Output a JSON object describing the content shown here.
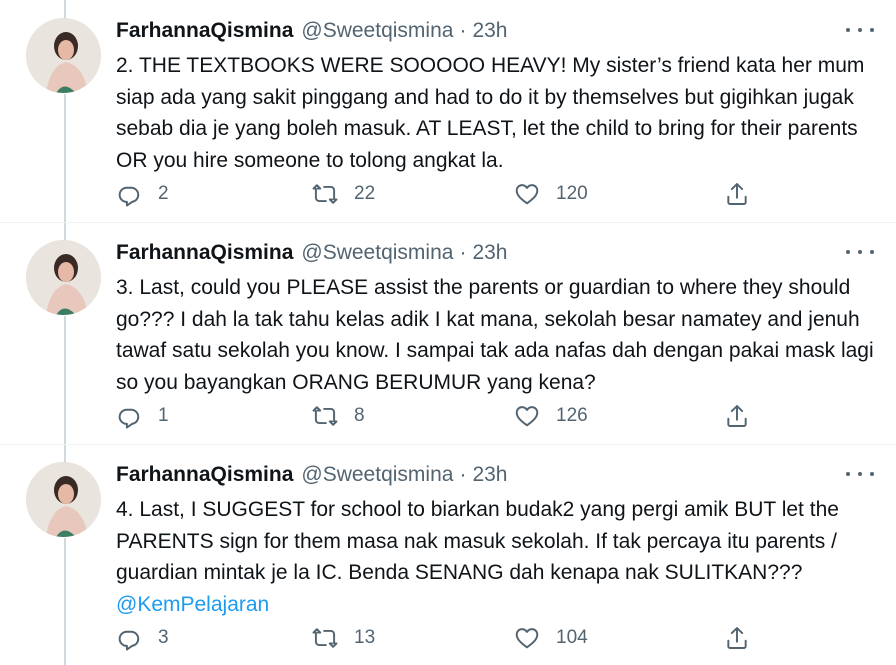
{
  "tweets": [
    {
      "name": "FarhannaQismina",
      "handle": "@Sweetqismina",
      "separator": "·",
      "time": "23h",
      "text": "2. THE TEXTBOOKS WERE SOOOOO HEAVY! My sister’s friend kata her mum siap ada yang sakit pinggang and had to do it by themselves but gigihkan jugak sebab dia je yang boleh masuk. AT LEAST, let the child to bring for their parents OR you hire someone to tolong angkat la.",
      "mention": "",
      "replies": "2",
      "retweets": "22",
      "likes": "120"
    },
    {
      "name": "FarhannaQismina",
      "handle": "@Sweetqismina",
      "separator": "·",
      "time": "23h",
      "text": "3. Last, could you PLEASE assist the parents or guardian to where they should go??? I dah la tak tahu kelas adik I kat mana, sekolah besar namatey and jenuh tawaf satu sekolah you know. I sampai tak ada nafas dah dengan pakai mask lagi so you bayangkan ORANG BERUMUR yang kena?",
      "mention": "",
      "replies": "1",
      "retweets": "8",
      "likes": "126"
    },
    {
      "name": "FarhannaQismina",
      "handle": "@Sweetqismina",
      "separator": "·",
      "time": "23h",
      "text": "4. Last, I SUGGEST for school to biarkan budak2 yang pergi amik BUT let the PARENTS sign for them masa nak masuk sekolah. If tak percaya itu parents / guardian mintak je la IC. Benda SENANG dah kenapa nak SULITKAN???",
      "mention": "@KemPelajaran",
      "replies": "3",
      "retweets": "13",
      "likes": "104"
    }
  ],
  "icons": {
    "reply": "reply-icon",
    "retweet": "retweet-icon",
    "like": "heart-icon",
    "share": "share-icon",
    "more": "more-icon"
  },
  "colors": {
    "text": "#0f1419",
    "secondary": "#536471",
    "link": "#1d9bf0",
    "thread_line": "#cfd9de"
  }
}
